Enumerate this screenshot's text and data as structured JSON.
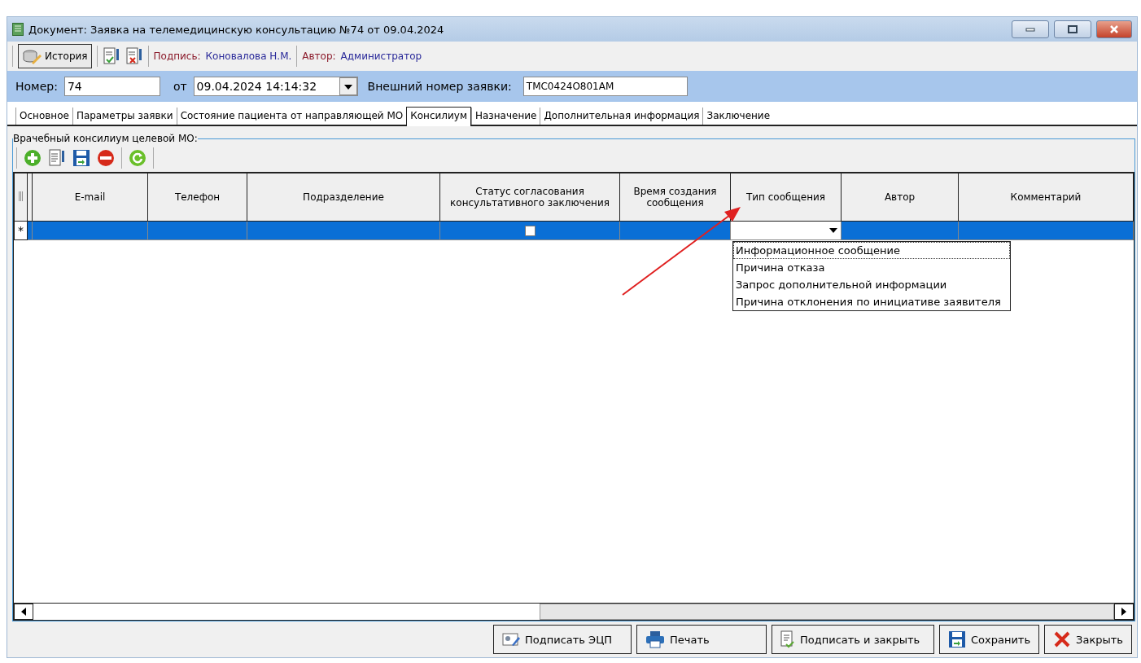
{
  "window": {
    "title": "Документ: Заявка на телемедицинскую консультацию №74 от 09.04.2024"
  },
  "toolbar": {
    "history": "История",
    "signature": {
      "label": "Подпись:",
      "value": "Коновалова Н.М."
    },
    "author": {
      "label": "Автор:",
      "value": "Администратор"
    }
  },
  "header": {
    "number_label": "Номер:",
    "number": "74",
    "date_label": "от",
    "date": "09.04.2024 14:14:32",
    "external_label": "Внешний номер заявки:",
    "external": "TMC0424O801AM"
  },
  "tabs": [
    {
      "label": "Основное",
      "selected": false
    },
    {
      "label": "Параметры заявки",
      "selected": false
    },
    {
      "label": "Состояние пациента от направляющей МО",
      "selected": false
    },
    {
      "label": "Консилиум",
      "selected": true
    },
    {
      "label": "Назначение",
      "selected": false
    },
    {
      "label": "Дополнительная информация",
      "selected": false
    },
    {
      "label": "Заключение",
      "selected": false
    }
  ],
  "group": {
    "title": "Врачебный консилиум целевой МО:",
    "grid": {
      "columns": [
        "E-mail",
        "Телефон",
        "Подразделение",
        "Статус согласования консультативного заключения",
        "Время создания сообщения",
        "Тип сообщения",
        "Автор",
        "Комментарий"
      ],
      "new_row": {
        "marker": "*",
        "selected": true,
        "status_checked": false
      },
      "dropdown": [
        {
          "label": "Информационное сообщение",
          "focused": true
        },
        {
          "label": "Причина отказа",
          "focused": false
        },
        {
          "label": "Запрос дополнительной информации",
          "focused": false
        },
        {
          "label": "Причина отклонения по инициативе заявителя",
          "focused": false
        }
      ]
    }
  },
  "buttons": [
    {
      "kind": "sign",
      "label": "Подписать ЭЦП"
    },
    {
      "kind": "print",
      "label": "Печать"
    },
    {
      "kind": "signclose",
      "label": "Подписать и закрыть"
    },
    {
      "kind": "save",
      "label": "Сохранить"
    },
    {
      "kind": "close",
      "label": "Закрыть"
    }
  ]
}
